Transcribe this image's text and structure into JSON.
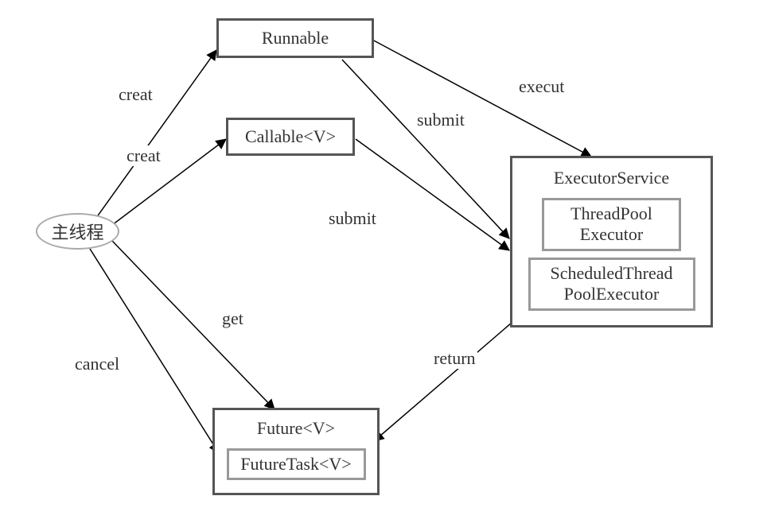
{
  "nodes": {
    "main_thread": "主线程",
    "runnable": "Runnable",
    "callable": "Callable<V>",
    "future": {
      "title": "Future<V>",
      "inner": "FutureTask<V>"
    },
    "executor": {
      "title": "ExecutorService",
      "inner1_line1": "ThreadPool",
      "inner1_line2": "Executor",
      "inner2_line1": "ScheduledThread",
      "inner2_line2": "PoolExecutor"
    }
  },
  "edges": {
    "creat1": "creat",
    "creat2": "creat",
    "get": "get",
    "cancel": "cancel",
    "execut": "execut",
    "submit1": "submit",
    "submit2": "submit",
    "return": "return"
  }
}
